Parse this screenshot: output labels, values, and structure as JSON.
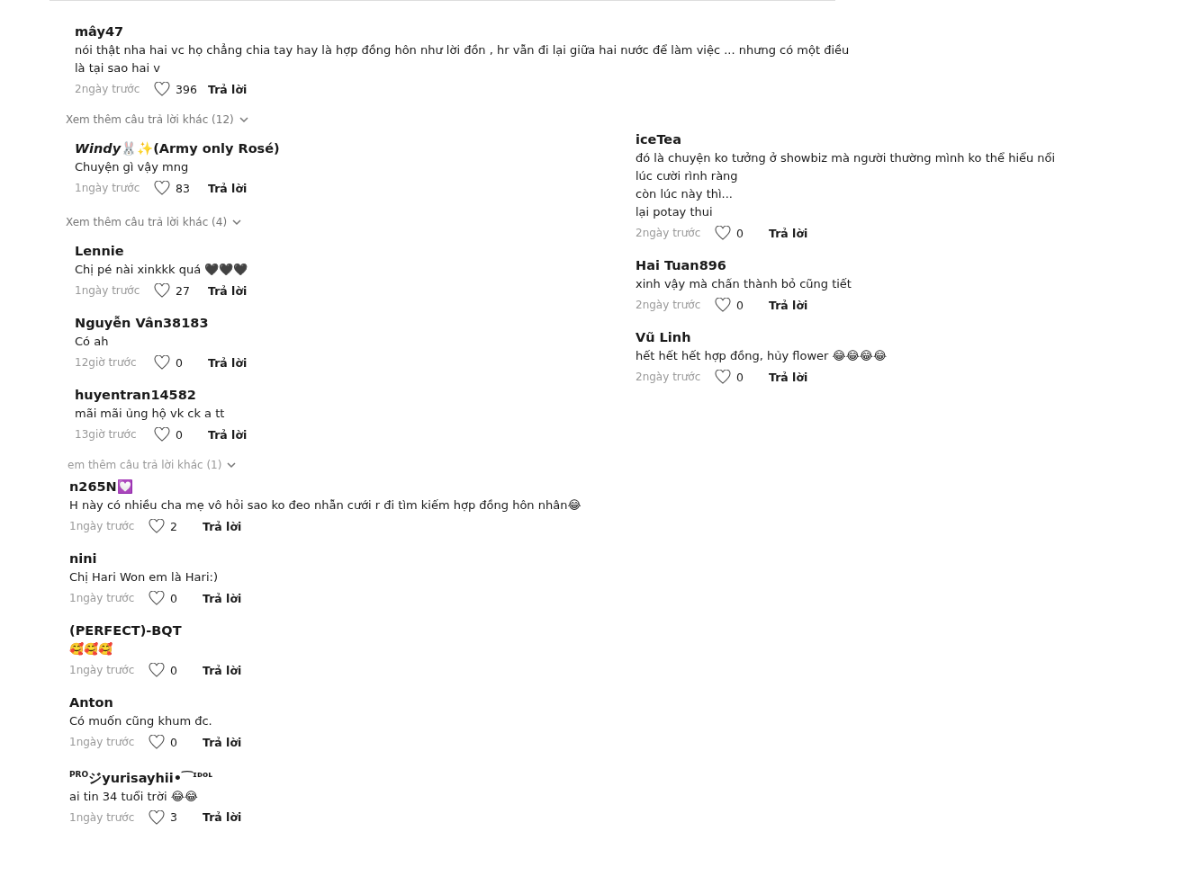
{
  "top": [
    {
      "kind": "reply",
      "name": "mây47",
      "lines": [
        "nói thật nha hai vc họ chẳng chia tay hay là hợp đồng hôn như lời đồn , hr vẫn đi lại giữa hai nước để làm việc ... nhưng có một điều",
        "là tại sao hai v"
      ],
      "time": "2ngày trước",
      "likes": "396",
      "reply": "Trả lời"
    },
    {
      "kind": "more",
      "label": "Xem thêm câu trả lời khác (12)"
    }
  ],
  "left": [
    {
      "kind": "reply",
      "name": "*Windy*🐰✨(Army only Rosé)",
      "lines": [
        "Chuyện gì vậy mng"
      ],
      "time": "1ngày trước",
      "likes": "83",
      "reply": "Trả lời"
    },
    {
      "kind": "more",
      "label": "Xem thêm câu trả lời khác (4)"
    },
    {
      "kind": "reply",
      "name": "Lennie",
      "lines": [
        "Chị pé nài xinkkk quá 🖤🖤🖤"
      ],
      "time": "1ngày trước",
      "likes": "27",
      "reply": "Trả lời"
    },
    {
      "kind": "reply",
      "name": "Nguyễn Vân38183",
      "lines": [
        "Có ah"
      ],
      "time": "12giờ trước",
      "likes": "0",
      "reply": "Trả lời"
    },
    {
      "kind": "reply",
      "name": "huyentran14582",
      "lines": [
        "mãi mãi ủng hộ vk ck a tt"
      ],
      "time": "13giờ trước",
      "likes": "0",
      "reply": "Trả lời"
    },
    {
      "kind": "cut",
      "label": "em thêm câu trả lời khác (1)"
    },
    {
      "kind": "comment",
      "name": "n265N💟",
      "lines": [
        "H này có nhiều cha mẹ vô hỏi sao ko đeo nhẫn cưới r đi tìm kiếm hợp đồng hôn nhân😂"
      ],
      "time": "1ngày trước",
      "likes": "2",
      "reply": "Trả lời"
    },
    {
      "kind": "comment",
      "name": "nini",
      "lines": [
        "Chị Hari Won em là Hari:)"
      ],
      "time": "1ngày trước",
      "likes": "0",
      "reply": "Trả lời"
    },
    {
      "kind": "comment",
      "name": "(PERFECT)-BQT",
      "lines": [
        "🥰🥰🥰"
      ],
      "time": "1ngày trước",
      "likes": "0",
      "reply": "Trả lời"
    },
    {
      "kind": "comment",
      "name": "Anton",
      "lines": [
        "Có muốn cũng khum đc."
      ],
      "time": "1ngày trước",
      "likes": "0",
      "reply": "Trả lời"
    },
    {
      "kind": "comment",
      "name": "$^{PRO}$ジyurisayhii•⁀$^{ɪᴅᴏʟ}$",
      "lines": [
        "ai tin 34 tuổi trời 😂😂"
      ],
      "time": "1ngày trước",
      "likes": "3",
      "reply": "Trả lời"
    }
  ],
  "right": [
    {
      "kind": "comment",
      "name": "iceTea",
      "lines": [
        "đó là chuyện ko tưởng ở showbiz mà người thường mình ko thể hiểu nổi",
        "lúc cười rình ràng",
        "còn lúc này thì...",
        "lại potay thui"
      ],
      "time": "2ngày trước",
      "likes": "0",
      "reply": "Trả lời"
    },
    {
      "kind": "comment",
      "name": "Hai Tuan896",
      "lines": [
        "xinh vậy mà chấn thành bỏ cũng tiết"
      ],
      "time": "2ngày trước",
      "likes": "0",
      "reply": "Trả lời"
    },
    {
      "kind": "comment",
      "name": "Vũ Linh",
      "lines": [
        "hết hết hết hợp đồng, hủy flower 😂😂😂😂"
      ],
      "time": "2ngày trước",
      "likes": "0",
      "reply": "Trả lời"
    }
  ]
}
